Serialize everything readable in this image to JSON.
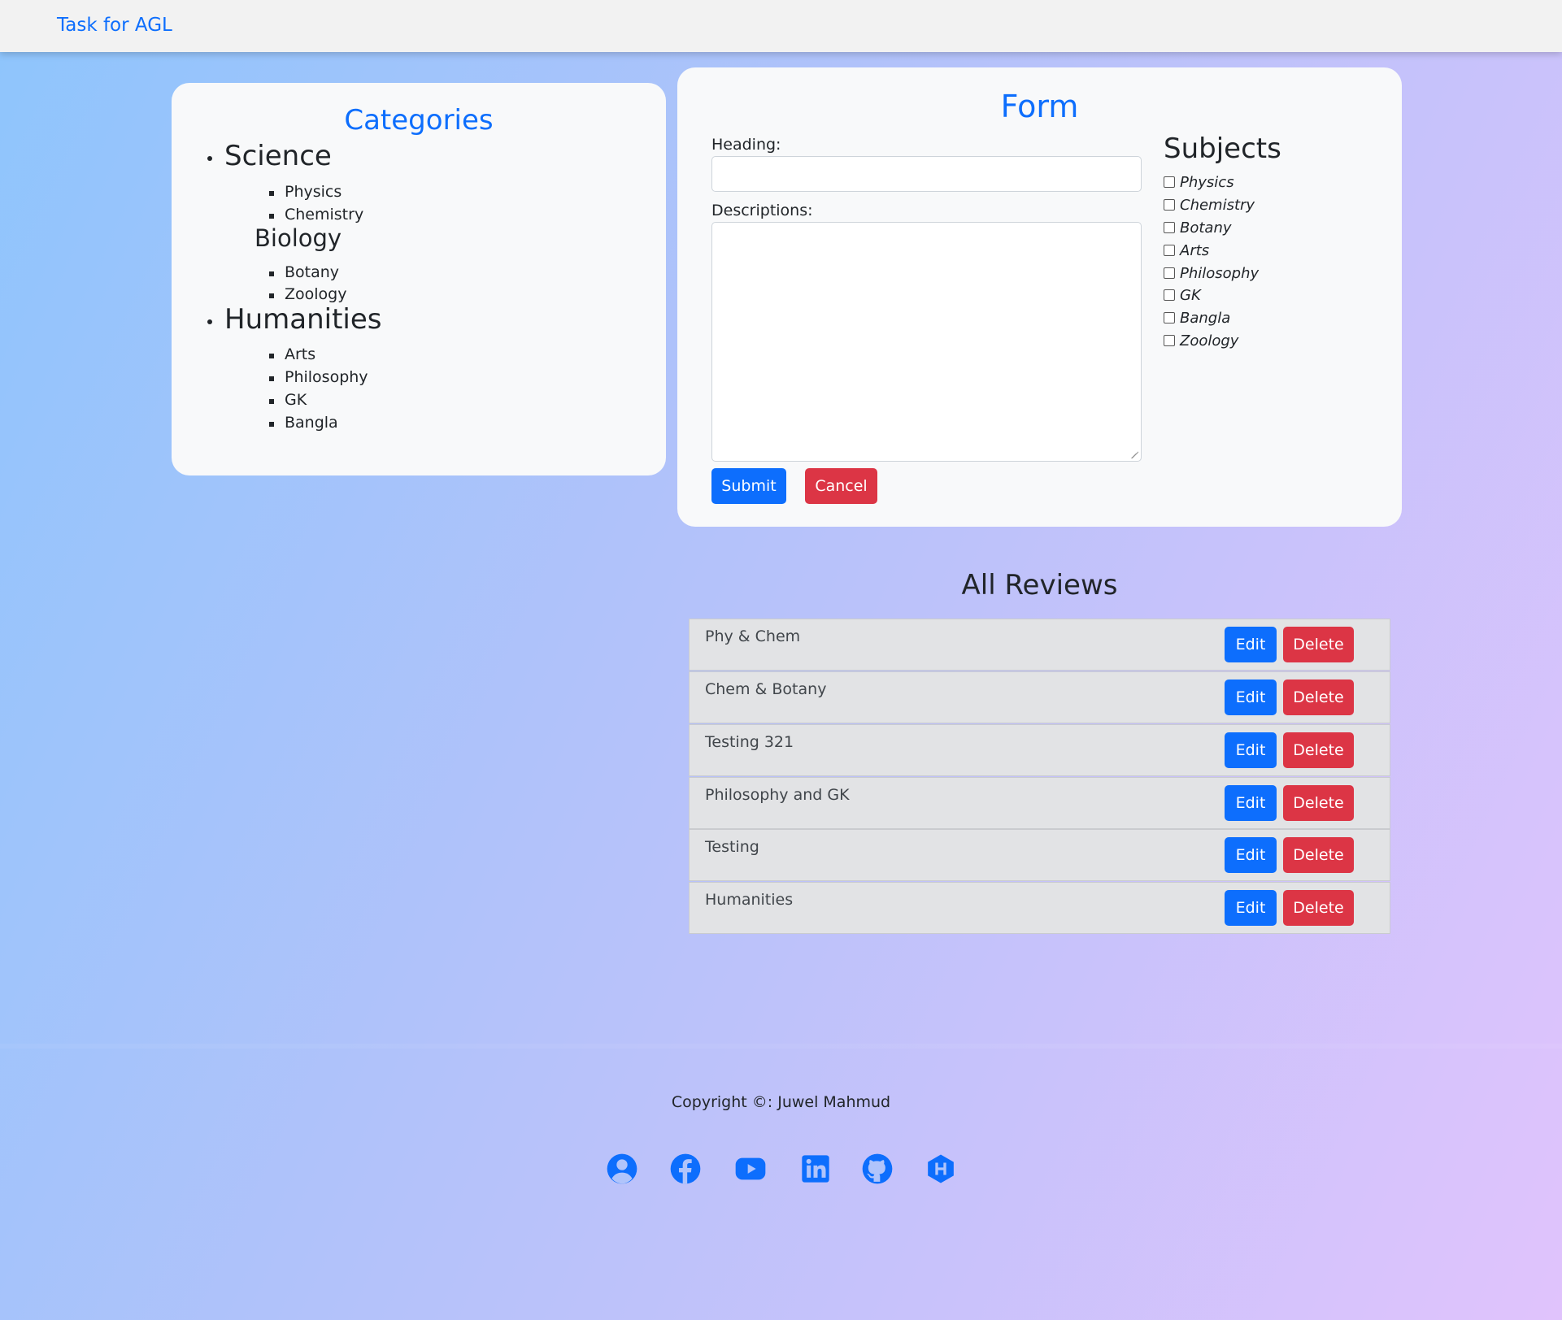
{
  "navbar": {
    "brand": "Task for AGL"
  },
  "categories": {
    "title": "Categories",
    "science": {
      "label": "Science",
      "items": [
        "Physics",
        "Chemistry"
      ]
    },
    "biology": {
      "label": "Biology",
      "items": [
        "Botany",
        "Zoology"
      ]
    },
    "humanities": {
      "label": "Humanities",
      "items": [
        "Arts",
        "Philosophy",
        "GK",
        "Bangla"
      ]
    }
  },
  "form": {
    "title": "Form",
    "heading_label": "Heading:",
    "heading_value": "",
    "descriptions_label": "Descriptions:",
    "descriptions_value": "",
    "submit_label": "Submit",
    "cancel_label": "Cancel",
    "subjects_title": "Subjects",
    "subjects": [
      "Physics",
      "Chemistry",
      "Botany",
      "Arts",
      "Philosophy",
      "GK",
      "Bangla",
      "Zoology"
    ]
  },
  "reviews": {
    "title": "All Reviews",
    "edit_label": "Edit",
    "delete_label": "Delete",
    "items": [
      "Phy & Chem",
      "Chem & Botany",
      "Testing 321",
      "Philosophy and GK",
      "Testing",
      "Humanities"
    ]
  },
  "footer": {
    "copyright": "Copyright ©: Juwel Mahmud",
    "socials": [
      "user-icon",
      "facebook-icon",
      "youtube-icon",
      "linkedin-icon",
      "github-icon",
      "hashnode-icon"
    ]
  },
  "colors": {
    "primary": "#0d6efd",
    "danger": "#dc3545",
    "card": "#f8f9fa",
    "review_bg": "#e2e3e5"
  }
}
